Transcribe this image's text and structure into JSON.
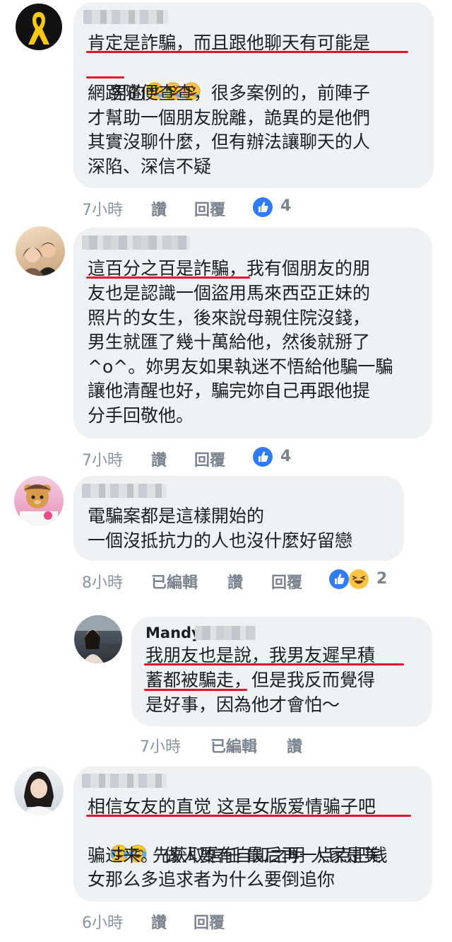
{
  "comments": [
    {
      "lines": [
        "肯定是詐騙，而且跟他聊天有可能是",
        "男的",
        "網路隨便查查，很多案例的，前陣子",
        "才幫助一個朋友脫離，詭異的是他們",
        "其實沒聊什麼，但有辦法讓聊天的人",
        "深陷、深信不疑"
      ],
      "time": "7小時",
      "like": "讚",
      "reply": "回覆",
      "reactions": "4"
    },
    {
      "lines": [
        "這百分之百是詐騙，我有個朋友的朋",
        "友也是認識一個盜用馬來西亞正妹的",
        "照片的女生，後來說母親住院沒錢，",
        "男生就匯了幾十萬給他，然後就掰了",
        "^o^。妳男友如果執迷不悟給他騙一騙",
        "讓他清醒也好，騙完妳自己再跟他提",
        "分手回敬他。"
      ],
      "time": "7小時",
      "like": "讚",
      "reply": "回覆",
      "reactions": "4"
    },
    {
      "lines": [
        "電騙案都是這樣開始的",
        "一個沒抵抗力的人也沒什麼好留戀"
      ],
      "time": "8小時",
      "edited": "已編輯",
      "like": "讚",
      "reply": "回覆",
      "reactions": "2"
    },
    {
      "name": "Mandy",
      "lines": [
        "我朋友也是說，我男友遲早積",
        "蓄都被騙走，但是我反而覺得",
        "是好事，因為他才會怕～"
      ],
      "time": "7小時",
      "edited": "已編輯",
      "like": "讚"
    },
    {
      "lines": [
        "相信女友的直觉 这是女版爱情骗子吧",
        "先获取信任 最后再一点点把钱",
        "骗过来。 做人要有自知之明 人家是美",
        "女那么多追求者为什么要倒追你"
      ],
      "time": "6小時",
      "like": "讚",
      "reply": "回覆"
    }
  ],
  "colors": {
    "bubble": "#eff1f3",
    "underline": "#e4112c",
    "meta": "#8d949e",
    "like_blue": "#2f7cf6",
    "haha_yellow": "#f7c543"
  },
  "icons": [
    "yellow-ribbon-icon",
    "like-reaction-icon",
    "haha-reaction-icon",
    "rofl-emoji",
    "tears-of-joy-emoji"
  ]
}
